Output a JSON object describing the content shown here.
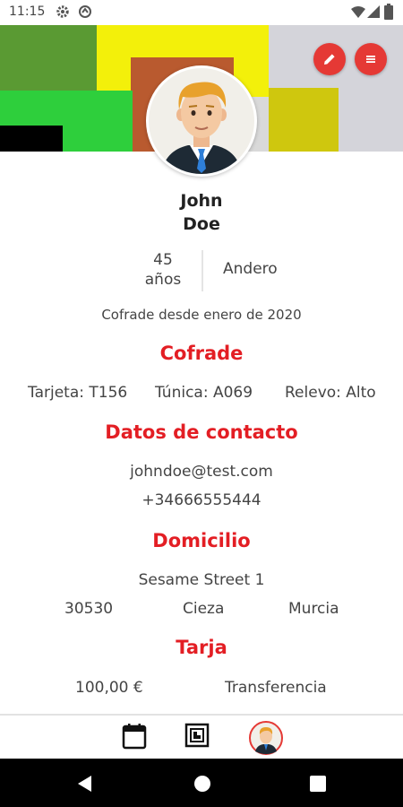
{
  "status_bar": {
    "time": "11:15",
    "icons": [
      "gear-icon",
      "vpn-icon",
      "wifi-icon",
      "signal-icon",
      "battery-icon"
    ]
  },
  "header": {
    "actions": [
      "edit-icon",
      "menu-icon"
    ],
    "accent_color": "#e53935",
    "avatar": "male-avatar"
  },
  "profile": {
    "first_name": "John",
    "last_name": "Doe",
    "age_value": "45",
    "age_unit": "años",
    "role": "Andero",
    "member_since": "Cofrade desde enero de 2020"
  },
  "cofrade": {
    "title": "Cofrade",
    "card": "Tarjeta: T156",
    "tunic": "Túnica: A069",
    "relay": "Relevo: Alto"
  },
  "contact": {
    "title": "Datos de contacto",
    "email": "johndoe@test.com",
    "phone": "+34666555444"
  },
  "address": {
    "title": "Domicilio",
    "street": "Sesame Street 1",
    "postal_code": "30530",
    "city": "Cieza",
    "province": "Murcia"
  },
  "fee": {
    "title": "Tarja",
    "amount": "100,00 €",
    "method": "Transferencia"
  },
  "colors": {
    "section_title": "#e31e24",
    "text": "#444444"
  },
  "bottom_nav": [
    "calendar-icon",
    "qr-scan-icon",
    "profile-avatar"
  ],
  "system_nav": [
    "back-icon",
    "home-icon",
    "recents-icon"
  ]
}
